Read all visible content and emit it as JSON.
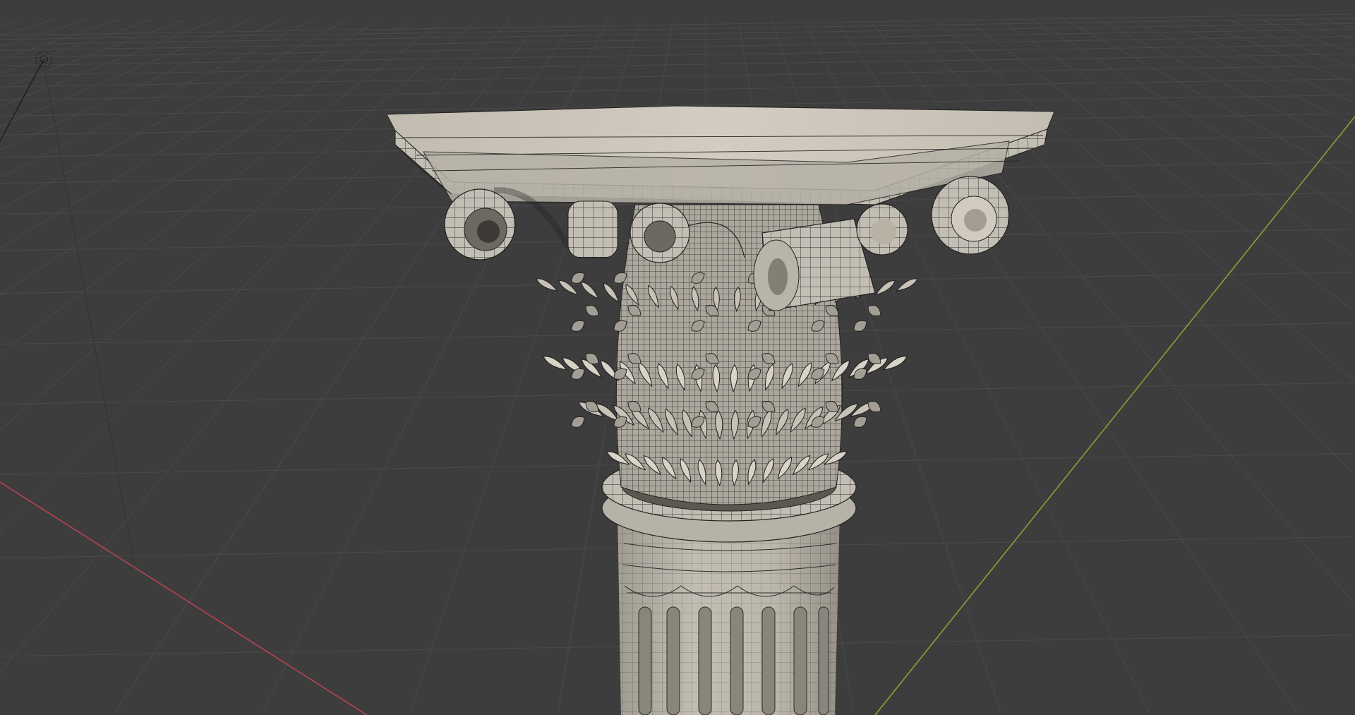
{
  "viewport": {
    "background": "#3d3d3d",
    "grid_color": "#4a4a4a",
    "grid_color_dim": "#454545",
    "x_axis_color": "#b8434f",
    "y_axis_color": "#7fa33a",
    "model": {
      "surface_color": "#c9c4b9",
      "surface_shade": "#9c978c",
      "surface_dark": "#6f6b63",
      "wire_color": "#1e1e1e",
      "icon": "corinthian-column-capital"
    },
    "light_icon": "light-sun-icon",
    "camera_icon": "camera-icon"
  }
}
